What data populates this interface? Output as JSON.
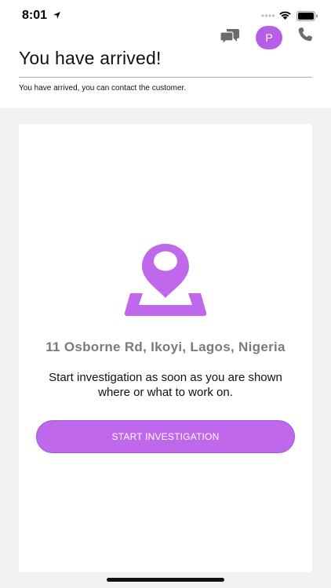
{
  "status_bar": {
    "time": "8:01"
  },
  "header": {
    "avatar_initial": "P",
    "title": "You have arrived!",
    "subtitle": "You have arrived, you can contact the customer."
  },
  "card": {
    "address": "11 Osborne Rd, Ikoyi, Lagos, Nigeria",
    "description": "Start investigation as soon as you are shown where or what to work on.",
    "button_label": "START INVESTIGATION"
  },
  "icons": {
    "chat": "chat-bubbles-icon",
    "phone": "phone-icon",
    "map_pin": "map-pin-icon"
  },
  "colors": {
    "accent": "#c068ec",
    "avatar": "#b65fe6",
    "address_text": "#7a7a7a",
    "background": "#f2f2f2"
  }
}
